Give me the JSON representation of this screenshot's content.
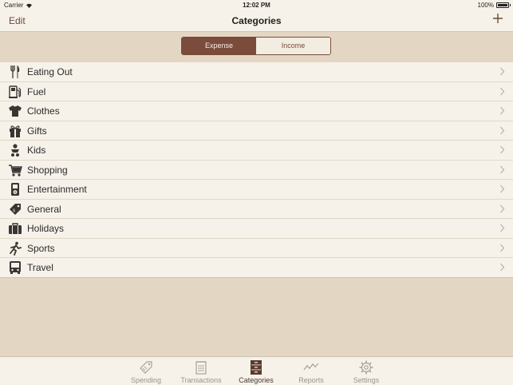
{
  "status_bar": {
    "carrier": "Carrier",
    "time": "12:02 PM",
    "battery": "100%",
    "battery_level": 1.0
  },
  "nav": {
    "edit_label": "Edit",
    "title": "Categories"
  },
  "segment": {
    "options": [
      "Expense",
      "Income"
    ],
    "selected": "Expense"
  },
  "categories": [
    {
      "label": "Eating Out",
      "icon": "fork-knife-icon"
    },
    {
      "label": "Fuel",
      "icon": "fuel-pump-icon"
    },
    {
      "label": "Clothes",
      "icon": "tshirt-icon"
    },
    {
      "label": "Gifts",
      "icon": "gift-icon"
    },
    {
      "label": "Kids",
      "icon": "baby-icon"
    },
    {
      "label": "Shopping",
      "icon": "cart-icon"
    },
    {
      "label": "Entertainment",
      "icon": "music-player-icon"
    },
    {
      "label": "General",
      "icon": "tag-icon"
    },
    {
      "label": "Holidays",
      "icon": "suitcase-icon"
    },
    {
      "label": "Sports",
      "icon": "runner-icon"
    },
    {
      "label": "Travel",
      "icon": "bus-icon"
    }
  ],
  "tabs": [
    {
      "label": "Spending",
      "icon": "price-tag-icon",
      "active": false
    },
    {
      "label": "Transactions",
      "icon": "notepad-icon",
      "active": false
    },
    {
      "label": "Categories",
      "icon": "drawer-icon",
      "active": true
    },
    {
      "label": "Reports",
      "icon": "trend-line-icon",
      "active": false
    },
    {
      "label": "Settings",
      "icon": "gear-icon",
      "active": false
    }
  ],
  "colors": {
    "accent": "#7b4b3c",
    "background": "#e3d7c4",
    "row_background": "#f6f2ea",
    "tab_inactive": "#9a938a"
  }
}
